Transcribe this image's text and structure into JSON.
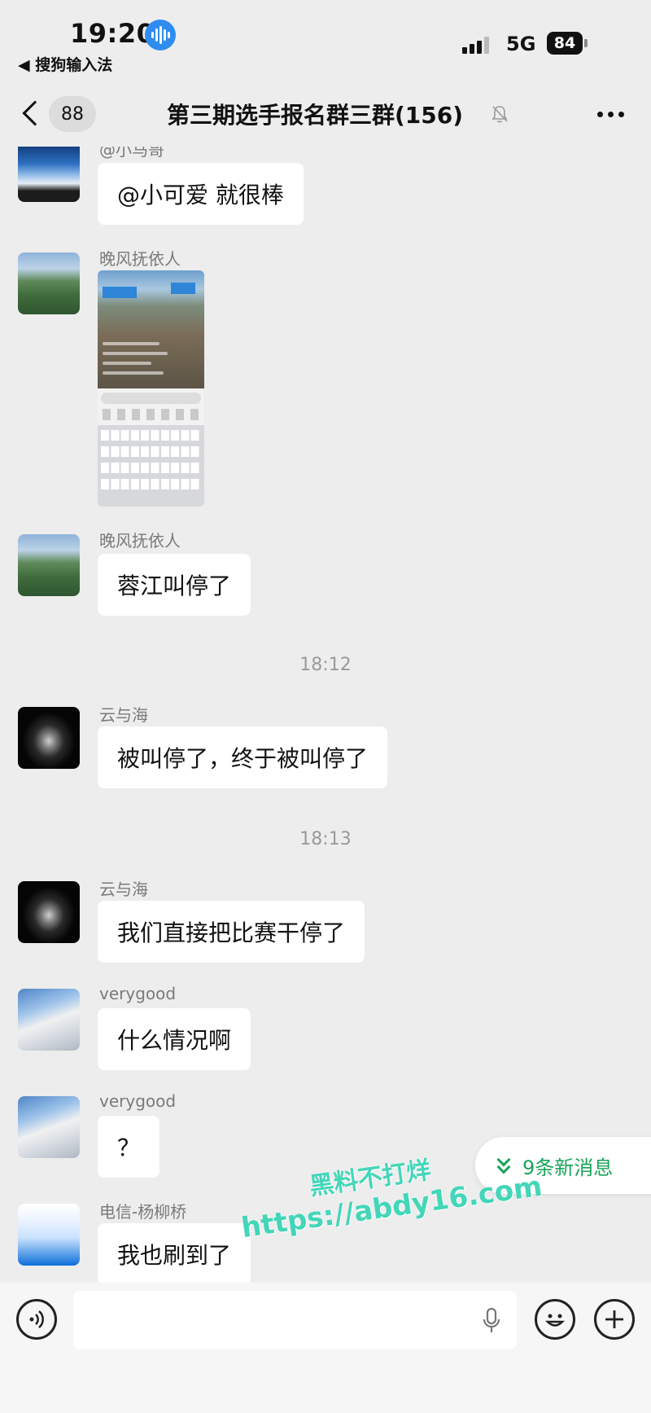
{
  "status_bar": {
    "time": "19:20",
    "back_app": "◀ 搜狗输入法",
    "network": "5G",
    "battery": "84"
  },
  "nav": {
    "unread_count": "88",
    "title": "第三期选手报名群三群(156)"
  },
  "messages": [
    {
      "sender": "@小马哥",
      "text": "@小可爱 就很棒"
    },
    {
      "sender": "晚风抚依人",
      "type": "image"
    },
    {
      "sender": "晚风抚依人",
      "text": "蓉江叫停了"
    },
    {
      "timestamp": "18:12"
    },
    {
      "sender": "云与海",
      "text": "被叫停了，终于被叫停了"
    },
    {
      "timestamp": "18:13"
    },
    {
      "sender": "云与海",
      "text": "我们直接把比赛干停了"
    },
    {
      "sender": "verygood",
      "text": "什么情况啊"
    },
    {
      "sender": "verygood",
      "text": "？"
    },
    {
      "sender": "电信-杨柳桥",
      "text": "我也刷到了"
    }
  ],
  "new_messages": "9条新消息",
  "watermark": {
    "line1": "黑料不打烊",
    "line2": "https://abdy16.com"
  },
  "icons": {
    "voice": "voice-input-icon",
    "mic": "mic-icon",
    "emoji": "emoji-icon",
    "plus": "plus-icon"
  },
  "colors": {
    "background": "#ededed",
    "accent_green": "#1aa35a",
    "watermark": "#43d6b8"
  }
}
